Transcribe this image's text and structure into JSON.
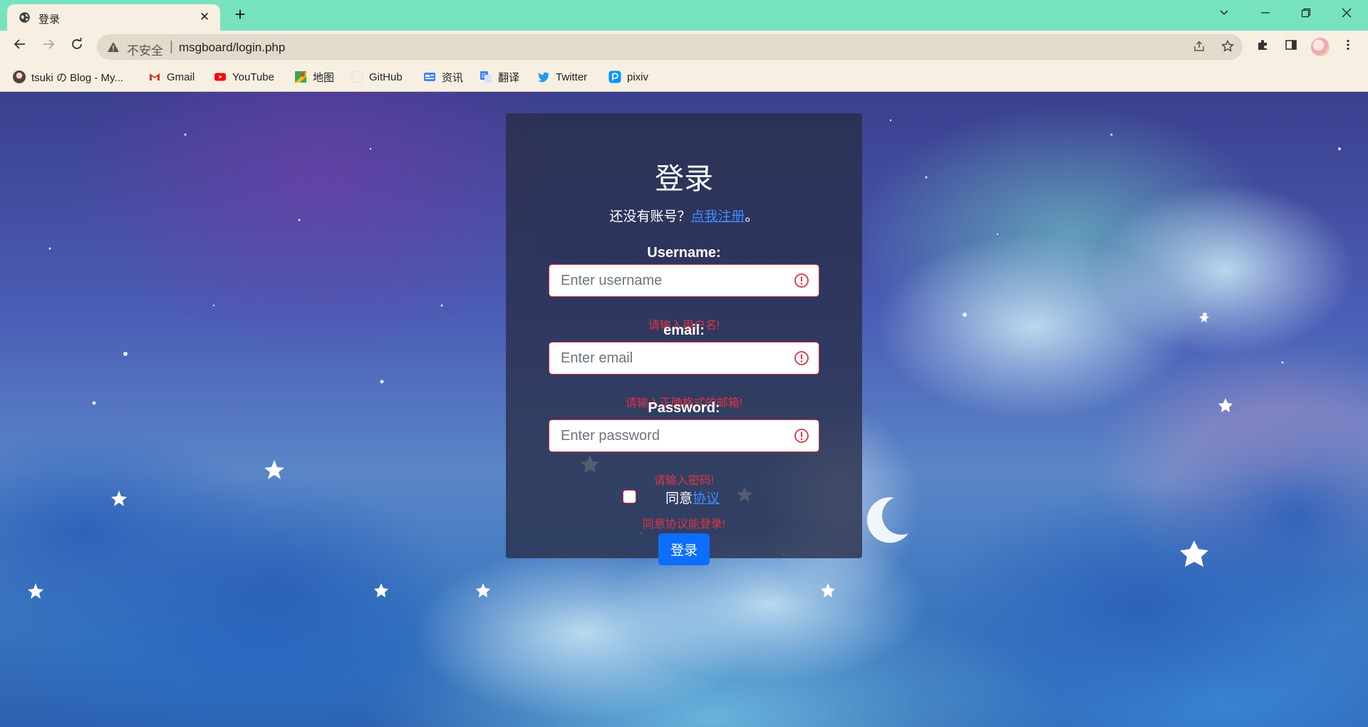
{
  "browser": {
    "tab_title": "登录",
    "tab_close": "✕",
    "new_tab": "+",
    "insecure_label": "不安全",
    "separator": "|",
    "url": "msgboard/login.php",
    "accent_color": "#77e3be",
    "chrome_color": "#f6efe2"
  },
  "bookmarks": [
    {
      "label": "tsuki の Blog - My...",
      "icon": "blog-avatar-icon"
    },
    {
      "label": "Gmail",
      "icon": "gmail-icon"
    },
    {
      "label": "YouTube",
      "icon": "youtube-icon"
    },
    {
      "label": "地图",
      "icon": "maps-icon"
    },
    {
      "label": "GitHub",
      "icon": "github-icon"
    },
    {
      "label": "资讯",
      "icon": "news-icon"
    },
    {
      "label": "翻译",
      "icon": "translate-icon"
    },
    {
      "label": "Twitter",
      "icon": "twitter-icon"
    },
    {
      "label": "pixiv",
      "icon": "pixiv-icon"
    }
  ],
  "login": {
    "title": "登录",
    "register_prefix": "还没有账号？",
    "register_link": "点我注册",
    "register_suffix": "。",
    "username_label": "Username:",
    "username_placeholder": "Enter username",
    "username_error": "请输入用户名!",
    "email_label": "email:",
    "email_placeholder": "Enter email",
    "email_error": "请输入正确格式的邮箱!",
    "password_label": "Password:",
    "password_placeholder": "Enter password",
    "password_error": "请输入密码!",
    "agree_prefix": "同意",
    "agree_link": "协议",
    "agree_error": "同意协议能登录!",
    "submit_label": "登录",
    "error_color": "#dc3545",
    "primary_color": "#0d6efd"
  }
}
